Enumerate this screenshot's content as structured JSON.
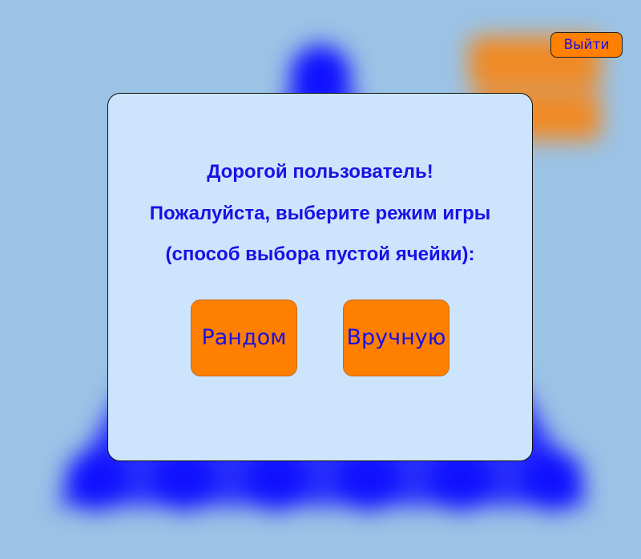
{
  "header": {
    "exit_label": "Выйти"
  },
  "dialog": {
    "lines": [
      "Дорогой пользователь!",
      "Пожалуйста, выберите режим игры",
      "(способ выбора пустой ячейки):"
    ],
    "buttons": {
      "random_label": "Рандом",
      "manual_label": "Вручную"
    }
  },
  "colors": {
    "background": "#9bc3e6",
    "board_pegs": "#1414ff",
    "dialog_bg": "#cce5fc",
    "button_orange": "#ff7f00",
    "text_blue": "#1a10e6"
  }
}
